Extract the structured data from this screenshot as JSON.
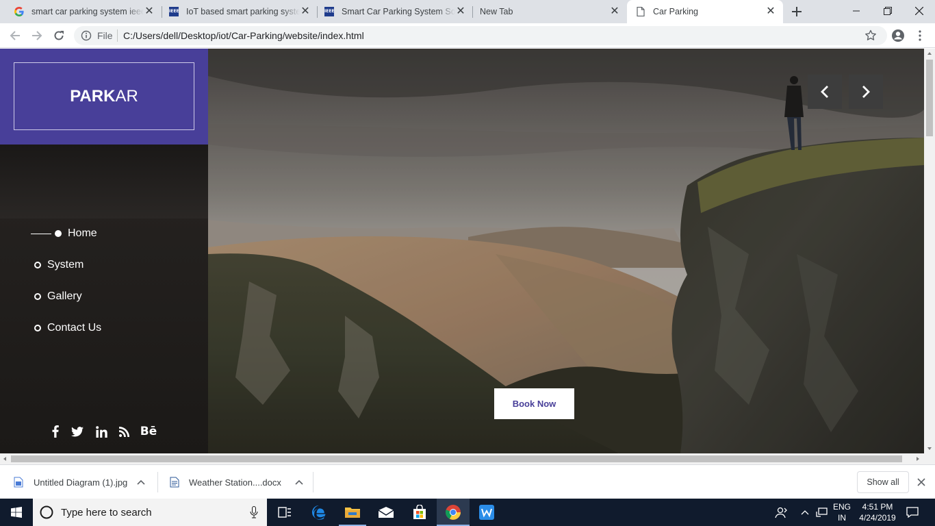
{
  "browser": {
    "tabs": [
      {
        "title": "smart car parking system ieee p",
        "favicon": "google-g-icon"
      },
      {
        "title": "IoT based smart parking system",
        "favicon": "ieee-icon"
      },
      {
        "title": "Smart Car Parking System Solu",
        "favicon": "ieee-icon"
      },
      {
        "title": "New Tab",
        "favicon": ""
      },
      {
        "title": "Car Parking",
        "favicon": "page-icon",
        "active": true
      }
    ],
    "omnibox": {
      "scheme_label": "File",
      "url": "C:/Users/dell/Desktop/iot/Car-Parking/website/index.html"
    }
  },
  "site": {
    "logo_bold": "PARK",
    "logo_light": "AR",
    "accent_color": "#483f99",
    "nav": [
      {
        "label": "Home",
        "active": true
      },
      {
        "label": "System"
      },
      {
        "label": "Gallery"
      },
      {
        "label": "Contact Us"
      }
    ],
    "social": [
      "facebook-icon",
      "twitter-icon",
      "linkedin-icon",
      "rss-icon",
      "behance-icon"
    ],
    "behance_text": "Bē",
    "cta": "Book Now"
  },
  "downloads": {
    "items": [
      {
        "name": "Untitled Diagram (1).jpg",
        "icon": "image-file-icon"
      },
      {
        "name": "Weather Station....docx",
        "icon": "word-file-icon"
      }
    ],
    "show_all": "Show all"
  },
  "taskbar": {
    "search_placeholder": "Type here to search",
    "lang_top": "ENG",
    "lang_bottom": "IN",
    "time": "4:51 PM",
    "date": "4/24/2019"
  }
}
